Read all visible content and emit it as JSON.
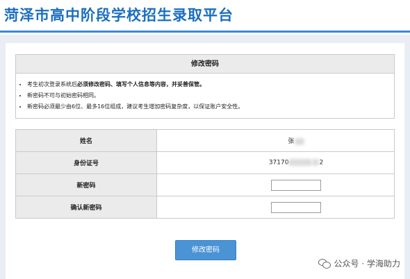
{
  "header": {
    "title": "菏泽市高中阶段学校招生录取平台"
  },
  "notice": {
    "title": "修改密码",
    "items": [
      {
        "prefix": "考生初次登录系统后",
        "emphasis": "必须修改密码、填写个人信息等内容，并妥善保管。"
      },
      {
        "prefix": "新密码不可与初始密码相同。",
        "emphasis": ""
      },
      {
        "prefix": "新密码必须最少由6位、最多16位组成，建议考生增加密码复杂度，以保证账户安全性。",
        "emphasis": ""
      }
    ]
  },
  "form": {
    "name_label": "姓名",
    "name_value": "张",
    "id_label": "身份证号",
    "id_prefix": "37170",
    "id_suffix": "2",
    "new_password_label": "新密码",
    "confirm_password_label": "确认新密码",
    "submit_label": "修改密码"
  },
  "watermark": {
    "text": "公众号 · 学海助力"
  },
  "colors": {
    "title": "#1a6ec0",
    "header_line": "#3a8ad8",
    "button": "#4a94d6"
  }
}
